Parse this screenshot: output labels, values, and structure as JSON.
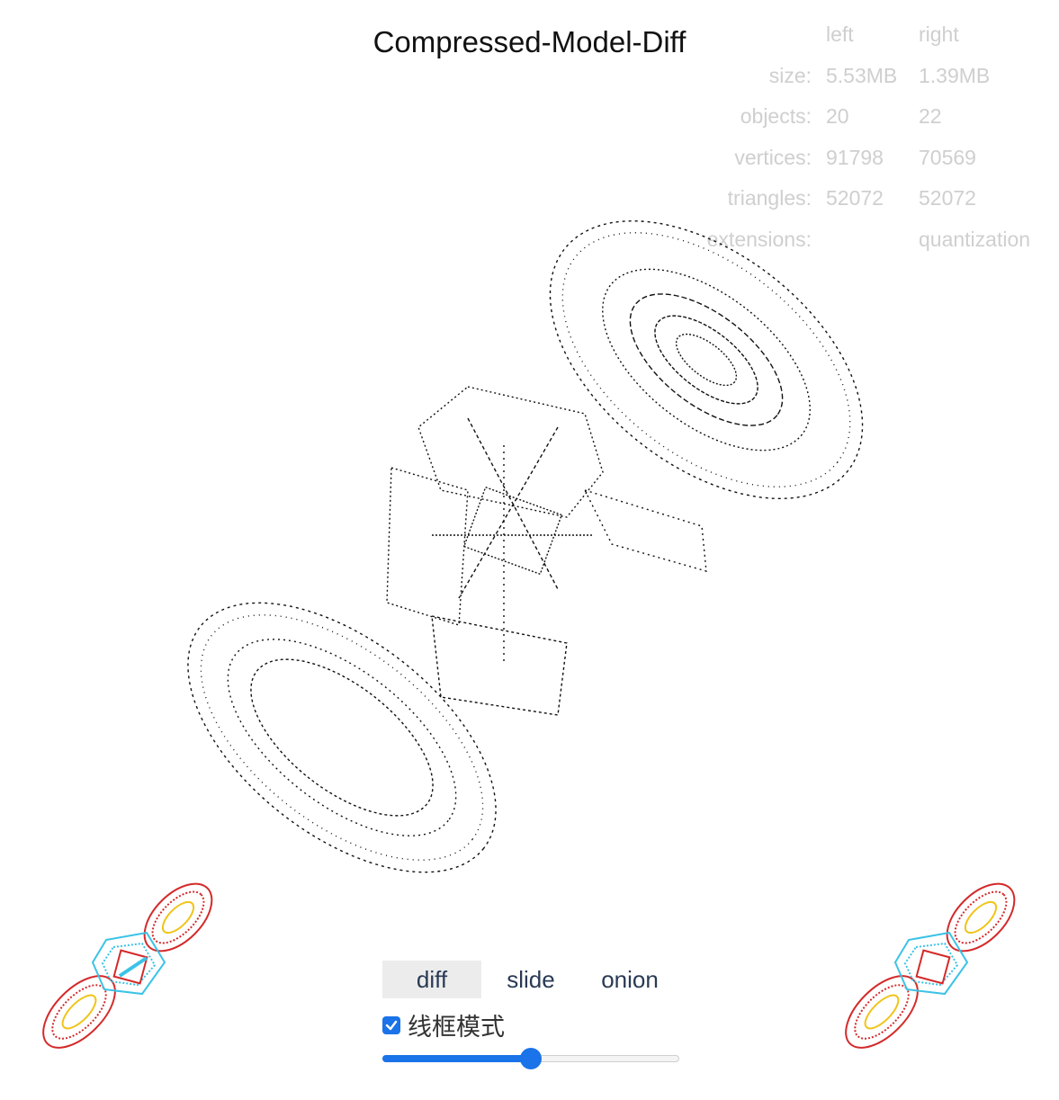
{
  "title": "Compressed-Model-Diff",
  "stats": {
    "header_left": "left",
    "header_right": "right",
    "rows": [
      {
        "label": "size:",
        "left": "5.53MB",
        "right": "1.39MB"
      },
      {
        "label": "objects:",
        "left": "20",
        "right": "22"
      },
      {
        "label": "vertices:",
        "left": "91798",
        "right": "70569"
      },
      {
        "label": "triangles:",
        "left": "52072",
        "right": "52072"
      },
      {
        "label": "extensions:",
        "left": "",
        "right": "quantization"
      }
    ]
  },
  "viewer": {
    "main_view_icon": "satellite-wireframe-diff",
    "left_thumb_icon": "satellite-wireframe-thumbnail",
    "right_thumb_icon": "satellite-wireframe-thumbnail"
  },
  "modes": {
    "tabs": [
      {
        "label": "diff"
      },
      {
        "label": "slide"
      },
      {
        "label": "onion"
      }
    ],
    "active": "diff"
  },
  "wireframe": {
    "label": "线框模式",
    "checked": true
  },
  "slider": {
    "value": 0.5
  },
  "colors": {
    "accent": "#1a73e8",
    "thumb_red": "#d42a2a",
    "thumb_cyan": "#3bc3e6",
    "thumb_yellow": "#f0c419"
  }
}
